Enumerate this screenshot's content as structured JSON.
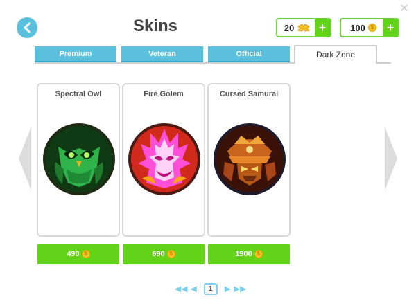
{
  "header": {
    "title": "Skins",
    "close_icon": "close-icon",
    "back_icon": "chevron-left-icon"
  },
  "currency": {
    "tickets": {
      "amount": "20",
      "icon": "ticket-icon",
      "plus": "+"
    },
    "coins": {
      "amount": "100",
      "icon": "coin-icon",
      "plus": "+"
    }
  },
  "tabs": [
    {
      "label": "Premium",
      "active": false
    },
    {
      "label": "Veteran",
      "active": false
    },
    {
      "label": "Official",
      "active": false
    },
    {
      "label": "Dark Zone",
      "active": true
    }
  ],
  "skins": [
    {
      "name": "Spectral Owl",
      "price": "490",
      "icon": "owl-skin-icon"
    },
    {
      "name": "Fire Golem",
      "price": "690",
      "icon": "fire-golem-skin-icon"
    },
    {
      "name": "Cursed Samurai",
      "price": "1900",
      "icon": "samurai-skin-icon"
    }
  ],
  "pagination": {
    "current_page": "1"
  },
  "colors": {
    "accent_blue": "#5bc0de",
    "buy_green": "#63d31a",
    "coin_gold": "#f6c324"
  }
}
